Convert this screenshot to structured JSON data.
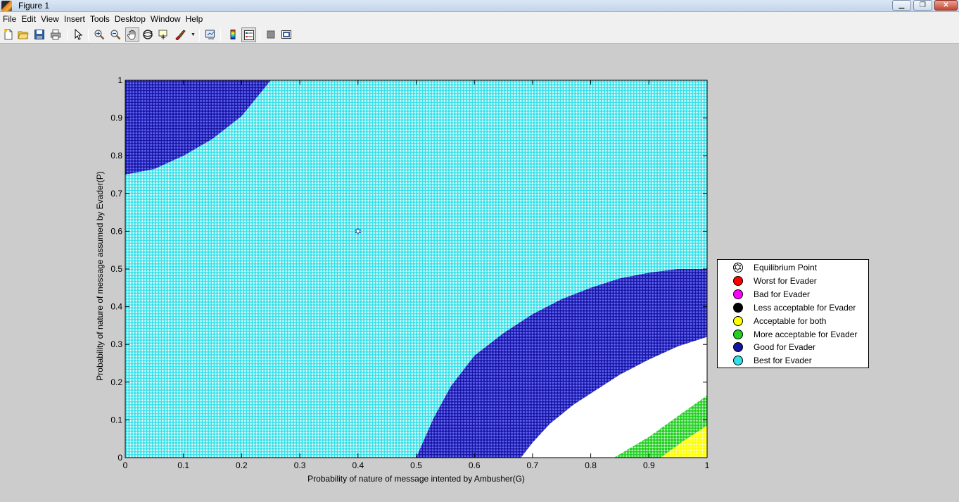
{
  "window": {
    "title": "Figure 1",
    "min_label": "▁",
    "max_label": "❐",
    "close_label": "✕"
  },
  "menu": [
    "File",
    "Edit",
    "View",
    "Insert",
    "Tools",
    "Desktop",
    "Window",
    "Help"
  ],
  "toolbar": {
    "icons": [
      "new-figure-icon",
      "open-file-icon",
      "save-icon",
      "print-icon",
      "pointer-icon",
      "zoom-in-icon",
      "zoom-out-icon",
      "pan-hand-icon",
      "rotate-3d-icon",
      "data-cursor-icon",
      "brush-icon",
      "link-plot-icon",
      "colorbar-icon",
      "legend-icon",
      "hide-plot-tools-icon",
      "show-plot-tools-icon"
    ],
    "pressed": "pan-hand-icon"
  },
  "colors": {
    "best": "#33e0e8",
    "good": "#1414a0",
    "more_acceptable": "#22d022",
    "acceptable_both": "#ffff00",
    "worst": "#ff0000",
    "bad": "#ff00ff",
    "less_acceptable": "#000000"
  },
  "chart_data": {
    "type": "scatter",
    "title": "",
    "xlabel": "Probability of nature of message intented by Ambusher(G)",
    "ylabel": "Probability of nature of message assumed by Evader(P)",
    "xlim": [
      0,
      1
    ],
    "ylim": [
      0,
      1
    ],
    "xticks": [
      "0",
      "0.1",
      "0.2",
      "0.3",
      "0.4",
      "0.5",
      "0.6",
      "0.7",
      "0.8",
      "0.9",
      "1"
    ],
    "yticks": [
      "0",
      "0.1",
      "0.2",
      "0.3",
      "0.4",
      "0.5",
      "0.6",
      "0.7",
      "0.8",
      "0.9",
      "1"
    ],
    "grid": false,
    "legend_position": "outside-right",
    "equilibrium_point": {
      "x": 0.4,
      "y": 0.6
    },
    "regions": {
      "good_top_left_boundary": [
        [
          0,
          0.75
        ],
        [
          0.05,
          0.765
        ],
        [
          0.1,
          0.8
        ],
        [
          0.15,
          0.845
        ],
        [
          0.2,
          0.905
        ],
        [
          0.25,
          1.0
        ]
      ],
      "good_bottom_right_left_boundary": [
        [
          0.5,
          0.0
        ],
        [
          0.53,
          0.105
        ],
        [
          0.56,
          0.19
        ],
        [
          0.6,
          0.27
        ],
        [
          0.65,
          0.33
        ],
        [
          0.7,
          0.38
        ],
        [
          0.75,
          0.42
        ],
        [
          0.8,
          0.45
        ],
        [
          0.85,
          0.475
        ],
        [
          0.9,
          0.49
        ],
        [
          0.95,
          0.5
        ],
        [
          1.0,
          0.5
        ]
      ],
      "white_top_boundary": [
        [
          0.68,
          0.0
        ],
        [
          0.7,
          0.04
        ],
        [
          0.73,
          0.09
        ],
        [
          0.77,
          0.14
        ],
        [
          0.8,
          0.17
        ],
        [
          0.85,
          0.22
        ],
        [
          0.9,
          0.26
        ],
        [
          0.95,
          0.295
        ],
        [
          1.0,
          0.32
        ]
      ],
      "green_top_boundary": [
        [
          0.84,
          0.0
        ],
        [
          0.9,
          0.055
        ],
        [
          0.95,
          0.11
        ],
        [
          1.0,
          0.165
        ]
      ],
      "yellow_top_boundary": [
        [
          0.92,
          0.0
        ],
        [
          0.96,
          0.045
        ],
        [
          1.0,
          0.085
        ]
      ]
    },
    "legend": [
      {
        "label": "Equilibrium Point",
        "color": "#ffffff",
        "marker": "hexagram"
      },
      {
        "label": "Worst for Evader",
        "color": "#ff0000",
        "marker": "circle"
      },
      {
        "label": "Bad for Evader",
        "color": "#ff00ff",
        "marker": "circle"
      },
      {
        "label": "Less acceptable for Evader",
        "color": "#000000",
        "marker": "circle"
      },
      {
        "label": "Acceptable for both",
        "color": "#ffff00",
        "marker": "circle"
      },
      {
        "label": "More acceptable for Evader",
        "color": "#22d022",
        "marker": "circle"
      },
      {
        "label": "Good for Evader",
        "color": "#1414a0",
        "marker": "circle"
      },
      {
        "label": "Best for Evader",
        "color": "#33e0e8",
        "marker": "circle"
      }
    ]
  }
}
